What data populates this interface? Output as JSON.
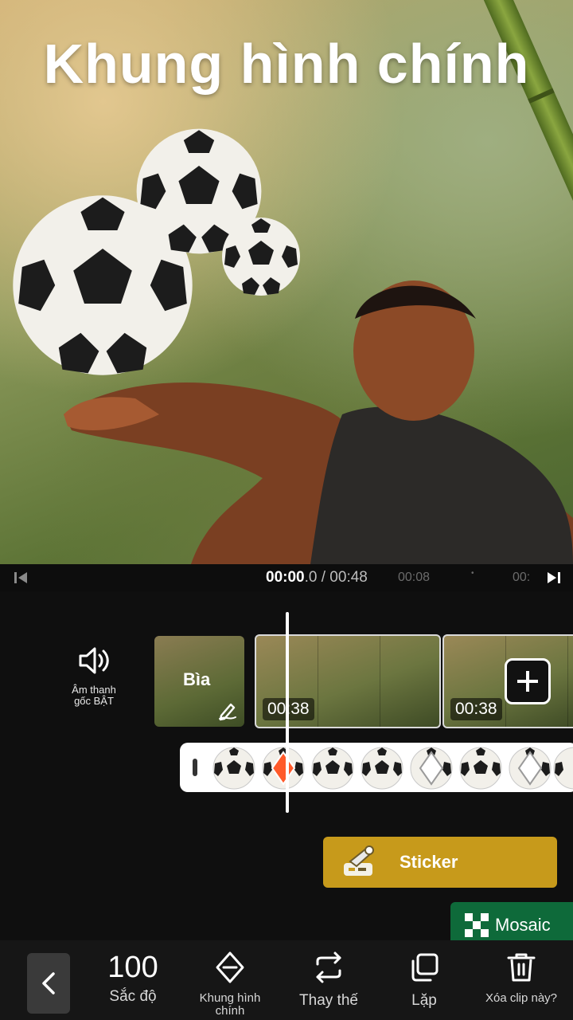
{
  "preview": {
    "title": "Khung hình chính"
  },
  "timeline": {
    "current_time": "00:00",
    "current_time_fraction": ".0",
    "total_time": " / 00:48",
    "tick_1": "00:08",
    "tick_2": "00:"
  },
  "audio_toggle": {
    "label_line1": "Âm thanh",
    "label_line2": "gốc BẬT"
  },
  "cover": {
    "label": "Bìa"
  },
  "clips": [
    {
      "duration": "00:38"
    },
    {
      "duration": "00:38"
    }
  ],
  "sticker_button": {
    "label": "Sticker"
  },
  "mosaic_button": {
    "label": "Mosaic"
  },
  "toolbar": {
    "intensity_value": "100",
    "intensity_label": "Sắc độ",
    "keyframe_label": "Khung hình chính",
    "replace_label": "Thay thế",
    "duplicate_label": "Lặp",
    "delete_label": "Xóa clip này?"
  },
  "colors": {
    "sticker_accent": "#c79a1b",
    "mosaic_accent": "#0e6a3a",
    "keyframe_active": "#ff5a2a"
  }
}
